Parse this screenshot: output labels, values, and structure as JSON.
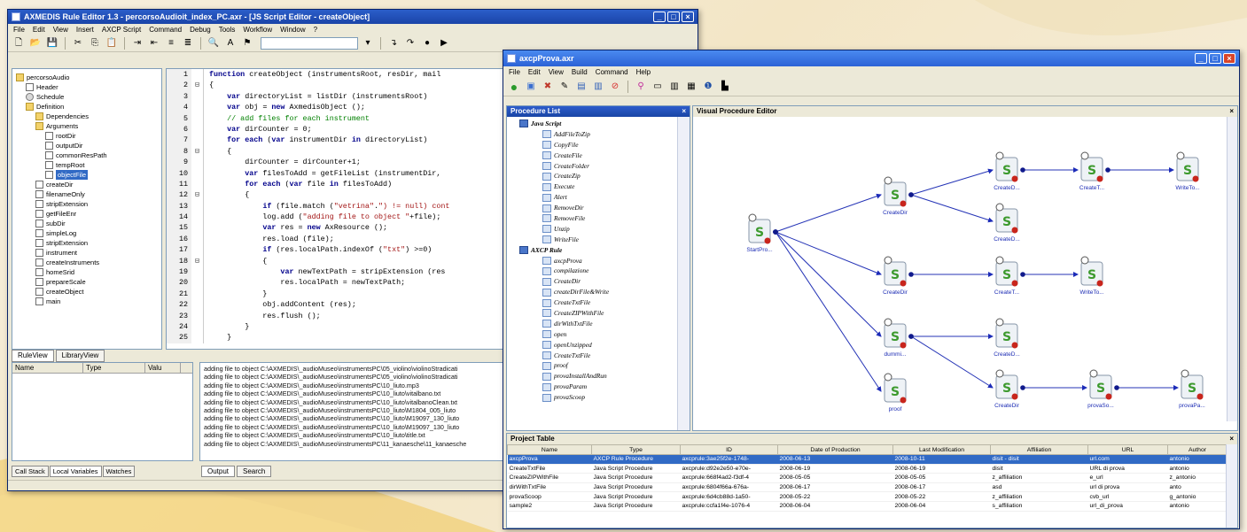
{
  "rule_editor": {
    "title": "AXMEDIS Rule Editor 1.3 - percorsoAudioit_index_PC.axr - [JS Script Editor - createObject]",
    "menu": [
      "File",
      "Edit",
      "View",
      "Insert",
      "AXCP Script",
      "Command",
      "Debug",
      "Tools",
      "Workflow",
      "Window",
      "?"
    ],
    "tree": [
      {
        "label": "percorsoAudio",
        "indent": 0,
        "icon": "folder"
      },
      {
        "label": "Header",
        "indent": 1,
        "icon": "doc"
      },
      {
        "label": "Schedule",
        "indent": 1,
        "icon": "gear"
      },
      {
        "label": "Definition",
        "indent": 1,
        "icon": "folder"
      },
      {
        "label": "Dependencies",
        "indent": 2,
        "icon": "folder"
      },
      {
        "label": "Arguments",
        "indent": 2,
        "icon": "folder"
      },
      {
        "label": "rootDir",
        "indent": 3,
        "icon": "doc"
      },
      {
        "label": "outputDir",
        "indent": 3,
        "icon": "doc"
      },
      {
        "label": "commonResPath",
        "indent": 3,
        "icon": "doc"
      },
      {
        "label": "tempRoot",
        "indent": 3,
        "icon": "doc"
      },
      {
        "label": "objectFile",
        "indent": 3,
        "icon": "doc",
        "selected": true
      },
      {
        "label": "createDir",
        "indent": 2,
        "icon": "doc"
      },
      {
        "label": "filenameOnly",
        "indent": 2,
        "icon": "doc"
      },
      {
        "label": "stripExtension",
        "indent": 2,
        "icon": "doc"
      },
      {
        "label": "getFileEnr",
        "indent": 2,
        "icon": "doc"
      },
      {
        "label": "subDir",
        "indent": 2,
        "icon": "doc"
      },
      {
        "label": "simpleLog",
        "indent": 2,
        "icon": "doc"
      },
      {
        "label": "stripExtension",
        "indent": 2,
        "icon": "doc"
      },
      {
        "label": "instrument",
        "indent": 2,
        "icon": "doc"
      },
      {
        "label": "createInstruments",
        "indent": 2,
        "icon": "doc"
      },
      {
        "label": "homeSrid",
        "indent": 2,
        "icon": "doc"
      },
      {
        "label": "prepareScale",
        "indent": 2,
        "icon": "doc"
      },
      {
        "label": "createObject",
        "indent": 2,
        "icon": "doc"
      },
      {
        "label": "main",
        "indent": 2,
        "icon": "doc"
      }
    ],
    "tree_tabs": [
      "RuleView",
      "LibraryView"
    ],
    "code_lines": [
      {
        "n": "1",
        "g": "",
        "t": "function createObject (instrumentsRoot, resDir, mail"
      },
      {
        "n": "2",
        "g": "⊟",
        "t": "{"
      },
      {
        "n": "3",
        "g": "",
        "t": "    var directoryList = listDir (instrumentsRoot)"
      },
      {
        "n": "4",
        "g": "",
        "t": "    var obj = new AxmedisObject ();"
      },
      {
        "n": "5",
        "g": "",
        "t": "    // add files for each instrument"
      },
      {
        "n": "6",
        "g": "",
        "t": "    var dirCounter = 0;"
      },
      {
        "n": "7",
        "g": "",
        "t": "    for each (var instrumentDir in directoryList)"
      },
      {
        "n": "8",
        "g": "⊟",
        "t": "    {"
      },
      {
        "n": "9",
        "g": "",
        "t": "        dirCounter = dirCounter+1;"
      },
      {
        "n": "10",
        "g": "",
        "t": "        var filesToAdd = getFileList (instrumentDir,"
      },
      {
        "n": "11",
        "g": "",
        "t": "        for each (var file in filesToAdd)"
      },
      {
        "n": "12",
        "g": "⊟",
        "t": "        {"
      },
      {
        "n": "13",
        "g": "",
        "t": "            if (file.match (\"vetrina\".\") != null) cont"
      },
      {
        "n": "14",
        "g": "",
        "t": "            log.add (\"adding file to object \"+file);"
      },
      {
        "n": "15",
        "g": "",
        "t": "            var res = new AxResource ();"
      },
      {
        "n": "16",
        "g": "",
        "t": "            res.load (file);"
      },
      {
        "n": "17",
        "g": "",
        "t": "            if (res.localPath.indexOf (\"txt\") >=0)"
      },
      {
        "n": "18",
        "g": "⊟",
        "t": "            {"
      },
      {
        "n": "19",
        "g": "",
        "t": "                var newTextPath = stripExtension (res"
      },
      {
        "n": "20",
        "g": "",
        "t": "                res.localPath = newTextPath;"
      },
      {
        "n": "21",
        "g": "",
        "t": "            }"
      },
      {
        "n": "22",
        "g": "",
        "t": "            obj.addContent (res);"
      },
      {
        "n": "23",
        "g": "",
        "t": "            res.flush ();"
      },
      {
        "n": "24",
        "g": "",
        "t": "        }"
      },
      {
        "n": "25",
        "g": "",
        "t": "    }"
      }
    ],
    "vars_columns": [
      "Name",
      "Type",
      "Valu"
    ],
    "bottom_left_tabs": [
      "Call Stack",
      "Local Variables",
      "Watches"
    ],
    "output_lines": [
      "adding file to object C:\\AXMEDIS\\_audioMuseo\\instrumentsPC\\05_violino\\violinoStradicati",
      "adding file to object C:\\AXMEDIS\\_audioMuseo\\instrumentsPC\\05_violino\\violinoStradicati",
      "adding file to object C:\\AXMEDIS\\_audioMuseo\\instrumentsPC\\10_liuto.mp3",
      "adding file to object C:\\AXMEDIS\\_audioMuseo\\instrumentsPC\\10_liuto\\vitalbano.txt",
      "adding file to object C:\\AXMEDIS\\_audioMuseo\\instrumentsPC\\10_liuto\\vitalbanoClean.txt",
      "adding file to object C:\\AXMEDIS\\_audioMuseo\\instrumentsPC\\10_liuto\\M1804_005_liuto",
      "adding file to object C:\\AXMEDIS\\_audioMuseo\\instrumentsPC\\10_liuto\\M19097_130_liuto",
      "adding file to object C:\\AXMEDIS\\_audioMuseo\\instrumentsPC\\10_liuto\\M19097_130_liuto",
      "adding file to object C:\\AXMEDIS\\_audioMuseo\\instrumentsPC\\10_liuto\\title.txt",
      "adding file to object C:\\AXMEDIS\\_audioMuseo\\instrumentsPC\\11_kanaesche\\11_kanaesche"
    ],
    "output_tabs": [
      "Output",
      "Search"
    ],
    "status": "Ln"
  },
  "axcp": {
    "title": "axcpProva.axr",
    "menu": [
      "File",
      "Edit",
      "View",
      "Build",
      "Command",
      "Help"
    ],
    "proc_list_title": "Procedure List",
    "procedures": [
      {
        "label": "Java Script",
        "group": true
      },
      {
        "label": "AddFileToZip"
      },
      {
        "label": "CopyFile"
      },
      {
        "label": "CreateFile"
      },
      {
        "label": "CreateFolder"
      },
      {
        "label": "CreateZip"
      },
      {
        "label": "Execute"
      },
      {
        "label": "Alert"
      },
      {
        "label": "RemoveDir"
      },
      {
        "label": "RemoveFile"
      },
      {
        "label": "Unzip"
      },
      {
        "label": "WriteFile"
      },
      {
        "label": "AXCP Rule",
        "group": true
      },
      {
        "label": "axcpProva"
      },
      {
        "label": "compilazione"
      },
      {
        "label": "CreateDir"
      },
      {
        "label": "createDirFile&Write"
      },
      {
        "label": "CreateTxtFile"
      },
      {
        "label": "CreateZIPWithFile"
      },
      {
        "label": "dirWithTxtFile"
      },
      {
        "label": "open"
      },
      {
        "label": "openUnzipped"
      },
      {
        "label": "CreateTxtFile"
      },
      {
        "label": "proof"
      },
      {
        "label": "provaInstallAndRun"
      },
      {
        "label": "provaParam"
      },
      {
        "label": "provaScoop"
      }
    ],
    "editor_title": "Visual Procedure Editor",
    "nodes": {
      "start": "StartPro...",
      "a1": "CreateDir",
      "a2": "CreateD...",
      "a3": "CreateT...",
      "a4": "WriteTo...",
      "a5": "CreateD...",
      "b1": "CreateDir",
      "b2": "CreateT...",
      "b3": "WriteTo...",
      "c1": "dummi...",
      "c2": "CreateD...",
      "d1": "proof",
      "d2": "CreateDir",
      "d3": "provaSo...",
      "d4": "provaPa..."
    },
    "table_title": "Project Table",
    "table_columns": [
      "Name",
      "Type",
      "ID",
      "Date of Production",
      "Last Modification",
      "Affiliation",
      "URL",
      "Author"
    ],
    "table_rows": [
      [
        "axcpProva",
        "AXCP Rule Procedure",
        "axcprule:3ae25f2e-1748-",
        "2008-06-13",
        "2008-10-11",
        "disit - disit",
        "url.com",
        "antonio"
      ],
      [
        "CreateTxtFile",
        "Java Script Procedure",
        "axcprule:d92e2e50-e70e-",
        "2008-06-19",
        "2008-06-19",
        "disit",
        "URL di prova",
        "antonio"
      ],
      [
        "CreateZIPWithFile",
        "Java Script Procedure",
        "axcprule:668f4ad2-f3df-4",
        "2008-05-05",
        "2008-05-05",
        "z_affiliation",
        "e_url",
        "z_antonio"
      ],
      [
        "dirWithTxtFile",
        "Java Script Procedure",
        "axcprule:6804f66a-676a-",
        "2008-06-17",
        "2008-06-17",
        "asd",
        "url di prova",
        "anto"
      ],
      [
        "provaScoop",
        "Java Script Procedure",
        "axcprule:6d4cb88d-1a50-",
        "2008-05-22",
        "2008-05-22",
        "z_affiliation",
        "cvb_url",
        "g_antonio"
      ],
      [
        "sample2",
        "Java Script Procedure",
        "axcprule:ccfa1f4e-1076-4",
        "2008-06-04",
        "2008-06-04",
        "s_affiliation",
        "url_di_prova",
        "antonio"
      ]
    ]
  }
}
